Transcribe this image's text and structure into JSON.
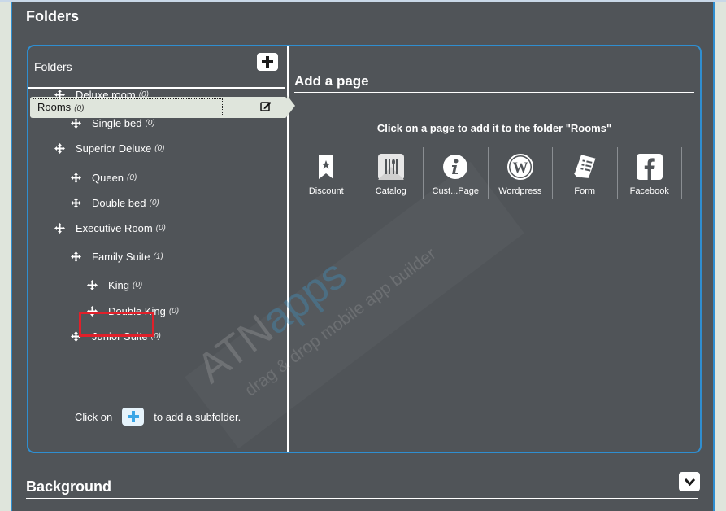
{
  "sections": {
    "folders_title": "Folders",
    "background_title": "Background"
  },
  "folders_panel": {
    "header": "Folders",
    "add_button_icon": "plus-icon",
    "selected": {
      "label": "Rooms",
      "count": "(0)",
      "edit_icon": "edit-icon"
    },
    "items": [
      {
        "label": "Deluxe room",
        "count": "(0)",
        "level": 1
      },
      {
        "label": "Single bed",
        "count": "(0)",
        "level": 2
      },
      {
        "label": "Superior Deluxe",
        "count": "(0)",
        "level": 1
      },
      {
        "label": "Queen",
        "count": "(0)",
        "level": 2
      },
      {
        "label": "Double bed",
        "count": "(0)",
        "level": 2
      },
      {
        "label": "Executive Room",
        "count": "(0)",
        "level": 1
      },
      {
        "label": "Family Suite",
        "count": "(1)",
        "level": 2
      },
      {
        "label": "King",
        "count": "(0)",
        "level": 3,
        "highlighted": true
      },
      {
        "label": "Double King",
        "count": "(0)",
        "level": 3
      },
      {
        "label": "Junior Suite",
        "count": "(0)",
        "level": 2
      }
    ],
    "hint_prefix": "Click on",
    "hint_suffix": "to add a subfolder."
  },
  "pages_panel": {
    "title": "Add a page",
    "hint": "Click on a page to add it to the folder \"Rooms\"",
    "pages": [
      {
        "label": "Discount",
        "icon": "bookmark-star-icon"
      },
      {
        "label": "Catalog",
        "icon": "cutlery-icon"
      },
      {
        "label": "Cust...Page",
        "icon": "info-icon"
      },
      {
        "label": "Wordpress",
        "icon": "wordpress-icon"
      },
      {
        "label": "Form",
        "icon": "form-scroll-icon"
      },
      {
        "label": "Facebook",
        "icon": "facebook-icon"
      }
    ]
  },
  "watermark": {
    "brand_a": "ATN",
    "brand_b": "apps",
    "tagline": "drag & drop mobile app builder"
  },
  "colors": {
    "panel_bg": "#505458",
    "accent_border": "#2f8ed0",
    "selected_bg": "#dfe5dc",
    "highlight": "#e0202a"
  }
}
